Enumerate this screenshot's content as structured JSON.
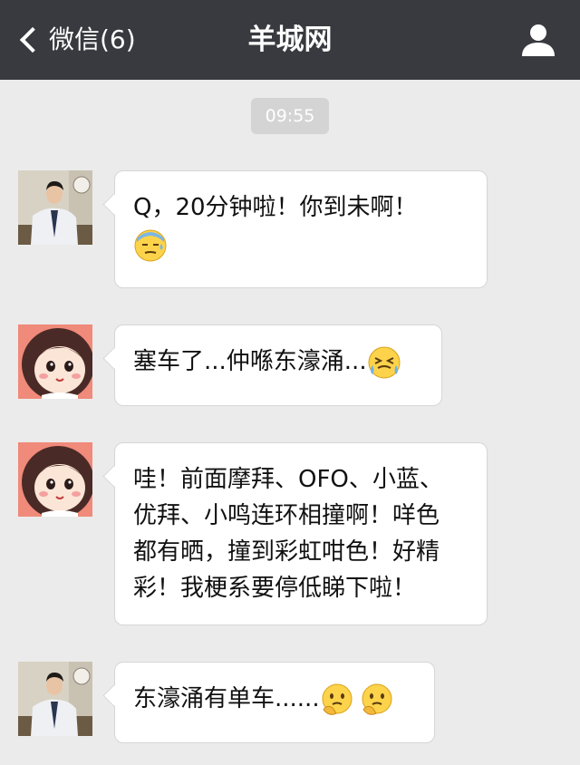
{
  "header": {
    "back_label": "微信(6)",
    "title": "羊城网"
  },
  "chat": {
    "timestamp": "09:55",
    "messages": [
      {
        "sender": "man",
        "lines": [
          "Q，20分钟啦！你到未啊！"
        ],
        "emojis": [
          "cold-sweat-emoji"
        ]
      },
      {
        "sender": "girl",
        "lines": [
          "塞车了...仲喺东濠涌..."
        ],
        "emojis": [
          "crying-laughing-emoji"
        ]
      },
      {
        "sender": "girl",
        "lines": [
          "哇！前面摩拜、OFO、小蓝、",
          "优拜、小鸣连环相撞啊！咩色",
          "都有晒，撞到彩虹咁色！好精",
          "彩！我梗系要停低睇下啦！"
        ],
        "emojis": []
      },
      {
        "sender": "man",
        "lines": [
          "东濠涌有单车......"
        ],
        "emojis": [
          "thinking-emoji",
          "thinking-emoji"
        ]
      }
    ]
  },
  "colors": {
    "header_bg": "#393a3f",
    "chat_bg": "#ebebeb",
    "bubble_bg": "#ffffff",
    "timestamp_bg": "#d4d4d4"
  }
}
